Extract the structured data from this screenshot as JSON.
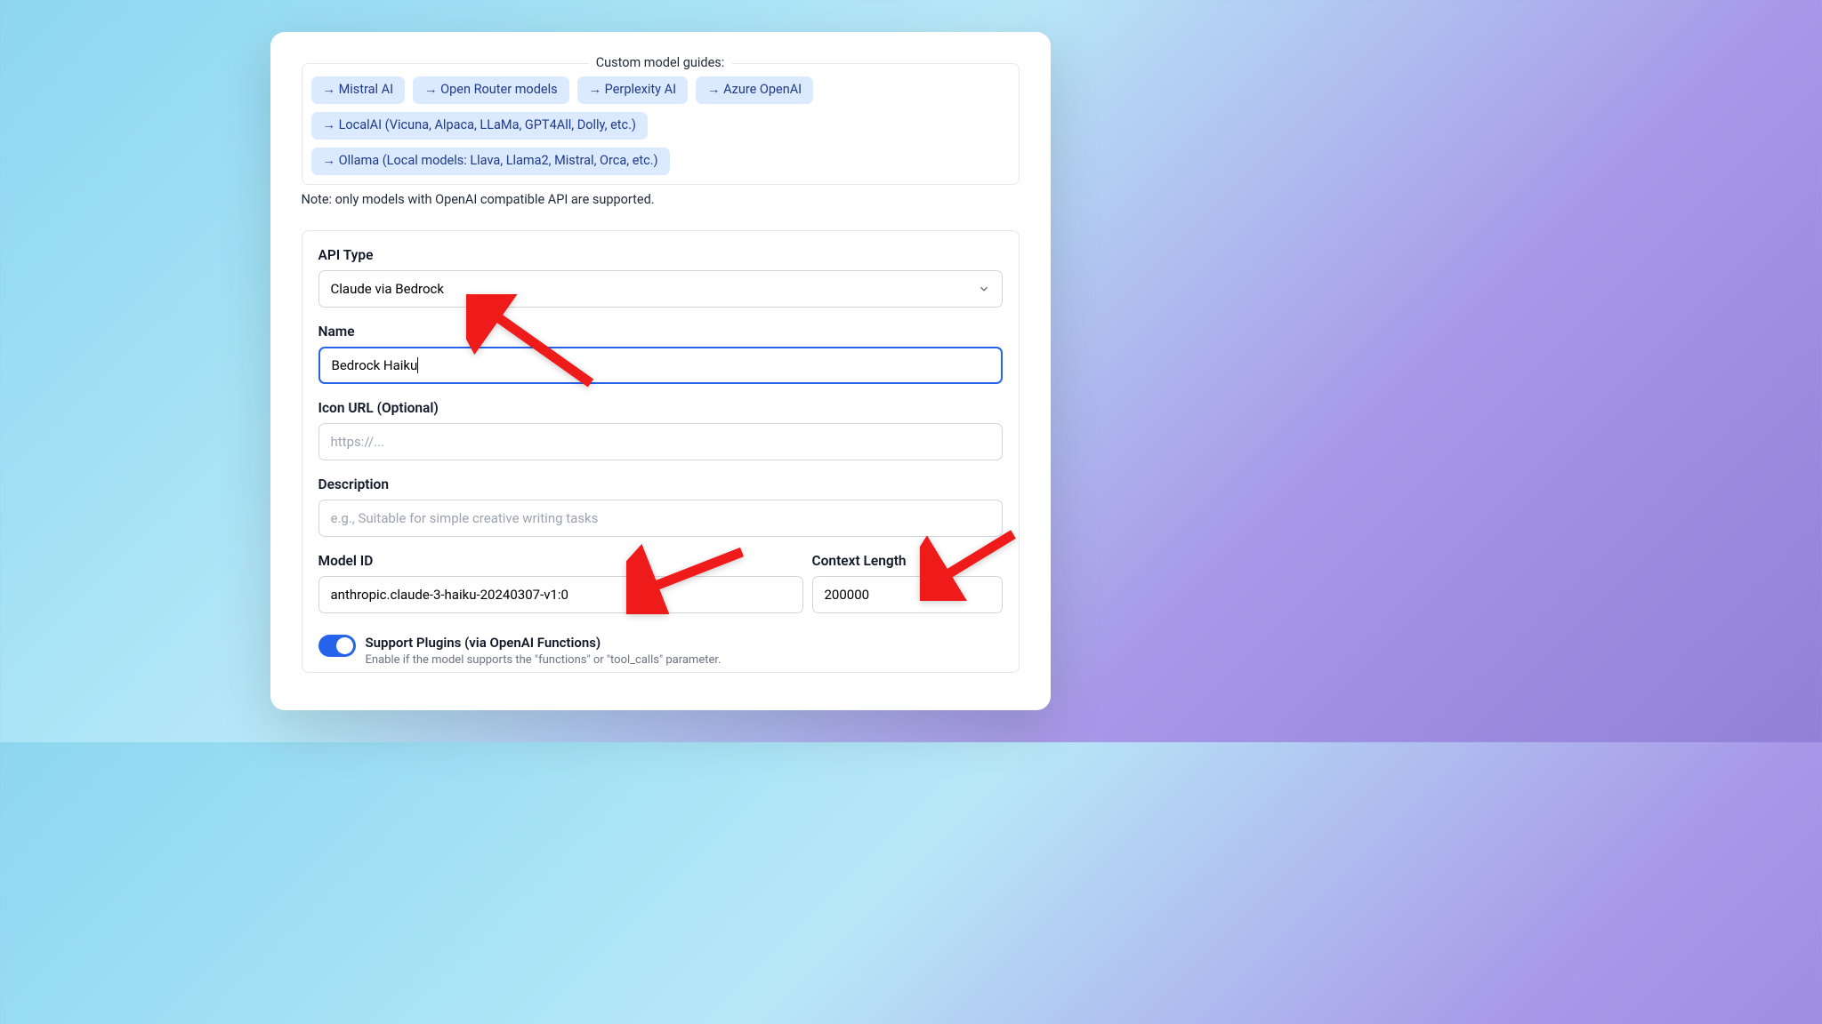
{
  "guides": {
    "title": "Custom model guides:",
    "items": [
      "→ Mistral AI",
      "→ Open Router models",
      "→ Perplexity AI",
      "→ Azure OpenAI",
      "→ LocalAI (Vicuna, Alpaca, LLaMa, GPT4All, Dolly, etc.)",
      "→ Ollama (Local models: Llava, Llama2, Mistral, Orca, etc.)"
    ]
  },
  "note": "Note: only models with OpenAI compatible API are supported.",
  "form": {
    "apiType": {
      "label": "API Type",
      "value": "Claude via Bedrock"
    },
    "name": {
      "label": "Name",
      "value": "Bedrock Haiku"
    },
    "iconUrl": {
      "label": "Icon URL (Optional)",
      "placeholder": "https://...",
      "value": ""
    },
    "description": {
      "label": "Description",
      "placeholder": "e.g., Suitable for simple creative writing tasks",
      "value": ""
    },
    "modelId": {
      "label": "Model ID",
      "value": "anthropic.claude-3-haiku-20240307-v1:0"
    },
    "contextLength": {
      "label": "Context Length",
      "value": "200000"
    },
    "plugins": {
      "title": "Support Plugins (via OpenAI Functions)",
      "subtitle": "Enable if the model supports the \"functions\" or \"tool_calls\" parameter."
    }
  }
}
